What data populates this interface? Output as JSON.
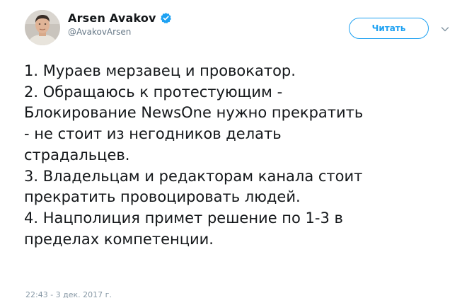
{
  "author": {
    "display_name": "Arsen Avakov",
    "handle": "@AvakovArsen",
    "verified": true,
    "avatar_icon": "profile-photo"
  },
  "actions": {
    "follow_label": "Читать",
    "menu_icon": "chevron-down-icon"
  },
  "tweet": {
    "lines": [
      "1. Мураев мерзавец и провокатор.",
      "2. Обращаюсь к протестующим -",
      "Блокирование NewsOne нужно прекратить",
      "- не стоит из негодников делать",
      "страдальцев.",
      "3. Владельцам и редакторам канала стоит",
      "прекратить провоцировать людей.",
      "4. Нацполиция примет решение по 1-3 в",
      "пределах компетенции."
    ],
    "timestamp": "22:43 - 3 дек. 2017 г."
  },
  "colors": {
    "accent": "#1da1f2",
    "text": "#14171a",
    "secondary": "#657786"
  }
}
